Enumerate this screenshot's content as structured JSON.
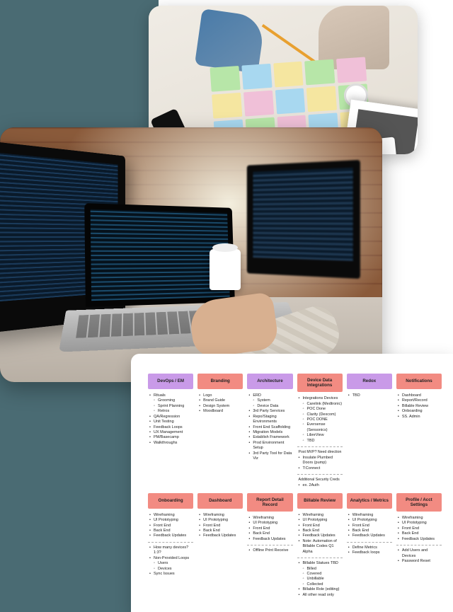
{
  "photos": {
    "top": "team-collaboration-sticky-notes",
    "middle": "developer-laptop-code-coffee"
  },
  "board": {
    "row1": [
      {
        "title": "DevOps / EM",
        "color": "purple",
        "items": [
          "Rituals",
          {
            "sub": true,
            "t": "Grooming"
          },
          {
            "sub": true,
            "t": "Sprint Planning"
          },
          {
            "sub": true,
            "t": "Retros"
          },
          "QA/Regression",
          "Unit Testing",
          "Feedback Loops",
          "UX Management",
          "PM/Basecamp",
          "Walkthroughs"
        ]
      },
      {
        "title": "Branding",
        "color": "coral",
        "items": [
          "Logo",
          "Brand Guide",
          "Design System",
          "Moodboard"
        ]
      },
      {
        "title": "Architecture",
        "color": "purple",
        "items": [
          "ERD",
          {
            "sub": true,
            "t": "System"
          },
          {
            "sub": true,
            "t": "Device Data"
          },
          "3rd Party Services",
          "Repo/Staging Environments",
          "Front End Scaffolding",
          "Migration Models",
          "Establish Framework",
          "Prod Environment Setup",
          "3rd Party Tool for Data Viz"
        ]
      },
      {
        "title": "Device Data Integrations",
        "color": "coral",
        "items": [
          "Integrations Devices",
          {
            "sub": true,
            "t": "Carelink (Medtronic)"
          },
          {
            "sub": true,
            "t": "POC Done"
          },
          {
            "sub": true,
            "t": "Clarity (Dexcom)"
          },
          {
            "sub": true,
            "t": "POC DONE"
          },
          {
            "sub": true,
            "t": "Eversense (Sensonics)"
          },
          {
            "sub": true,
            "t": "LibreView"
          },
          {
            "sub": true,
            "t": "TBD"
          }
        ],
        "sections": [
          {
            "note": "Post MVP? Need direction",
            "items": [
              "Insulate Plumbed Doors (pump)",
              "T:Connect"
            ]
          },
          {
            "note": "Additional Security Creds",
            "items": [
              "ex. 2Auth"
            ]
          }
        ]
      },
      {
        "title": "Redox",
        "color": "purple",
        "items": [
          "TBD"
        ]
      },
      {
        "title": "Notifications",
        "color": "coral",
        "items": [
          "Dashboard",
          "Report/Record",
          "Billable Review",
          "Onboarding",
          "SS. Admin"
        ]
      }
    ],
    "row2": [
      {
        "title": "Onboarding",
        "color": "coral",
        "items": [
          "Wireframing",
          "UI Prototyping",
          "Front End",
          "Back End",
          "Feedback Updates"
        ],
        "sections": [
          {
            "items": [
              "How many devices? 1:3?",
              "Non-Provided Loops",
              {
                "sub": true,
                "t": "Users"
              },
              {
                "sub": true,
                "t": "Devices"
              },
              "Sync Issues"
            ]
          }
        ]
      },
      {
        "title": "Dashboard",
        "color": "coral",
        "items": [
          "Wireframing",
          "UI Prototyping",
          "Front End",
          "Back End",
          "Feedback Updates"
        ]
      },
      {
        "title": "Report Detail Record",
        "color": "coral",
        "items": [
          "Wireframing",
          "UI Prototyping",
          "Front End",
          "Back End",
          "Feedback Updates"
        ],
        "sections": [
          {
            "items": [
              "Offline Print Receive"
            ]
          }
        ]
      },
      {
        "title": "Billable Review",
        "color": "coral",
        "items": [
          "Wireframing",
          "UI Prototyping",
          "Front End",
          "Back End",
          "Feedback Updates",
          "Note: Automation of Billable Codes Q1 Alpha"
        ],
        "sections": [
          {
            "items": [
              "Billable Statues TBD",
              {
                "sub": true,
                "t": "Billed"
              },
              {
                "sub": true,
                "t": "Covered"
              },
              {
                "sub": true,
                "t": "Unbillable"
              },
              {
                "sub": true,
                "t": "Collected"
              },
              "Billable Role (editing)",
              "All other read only"
            ]
          }
        ]
      },
      {
        "title": "Analytics / Metrics",
        "color": "coral",
        "items": [
          "Wireframing",
          "UI Prototyping",
          "Front End",
          "Back End",
          "Feedback Updates"
        ],
        "sections": [
          {
            "items": [
              "Define Metrics",
              "Feedback loops"
            ]
          }
        ]
      },
      {
        "title": "Profile / Acct Settings",
        "color": "coral",
        "items": [
          "Wireframing",
          "UI Prototyping",
          "Front End",
          "Back End",
          "Feedback Updates"
        ],
        "sections": [
          {
            "items": [
              "Add Users and Devices",
              "Password Reset"
            ]
          }
        ]
      }
    ]
  }
}
